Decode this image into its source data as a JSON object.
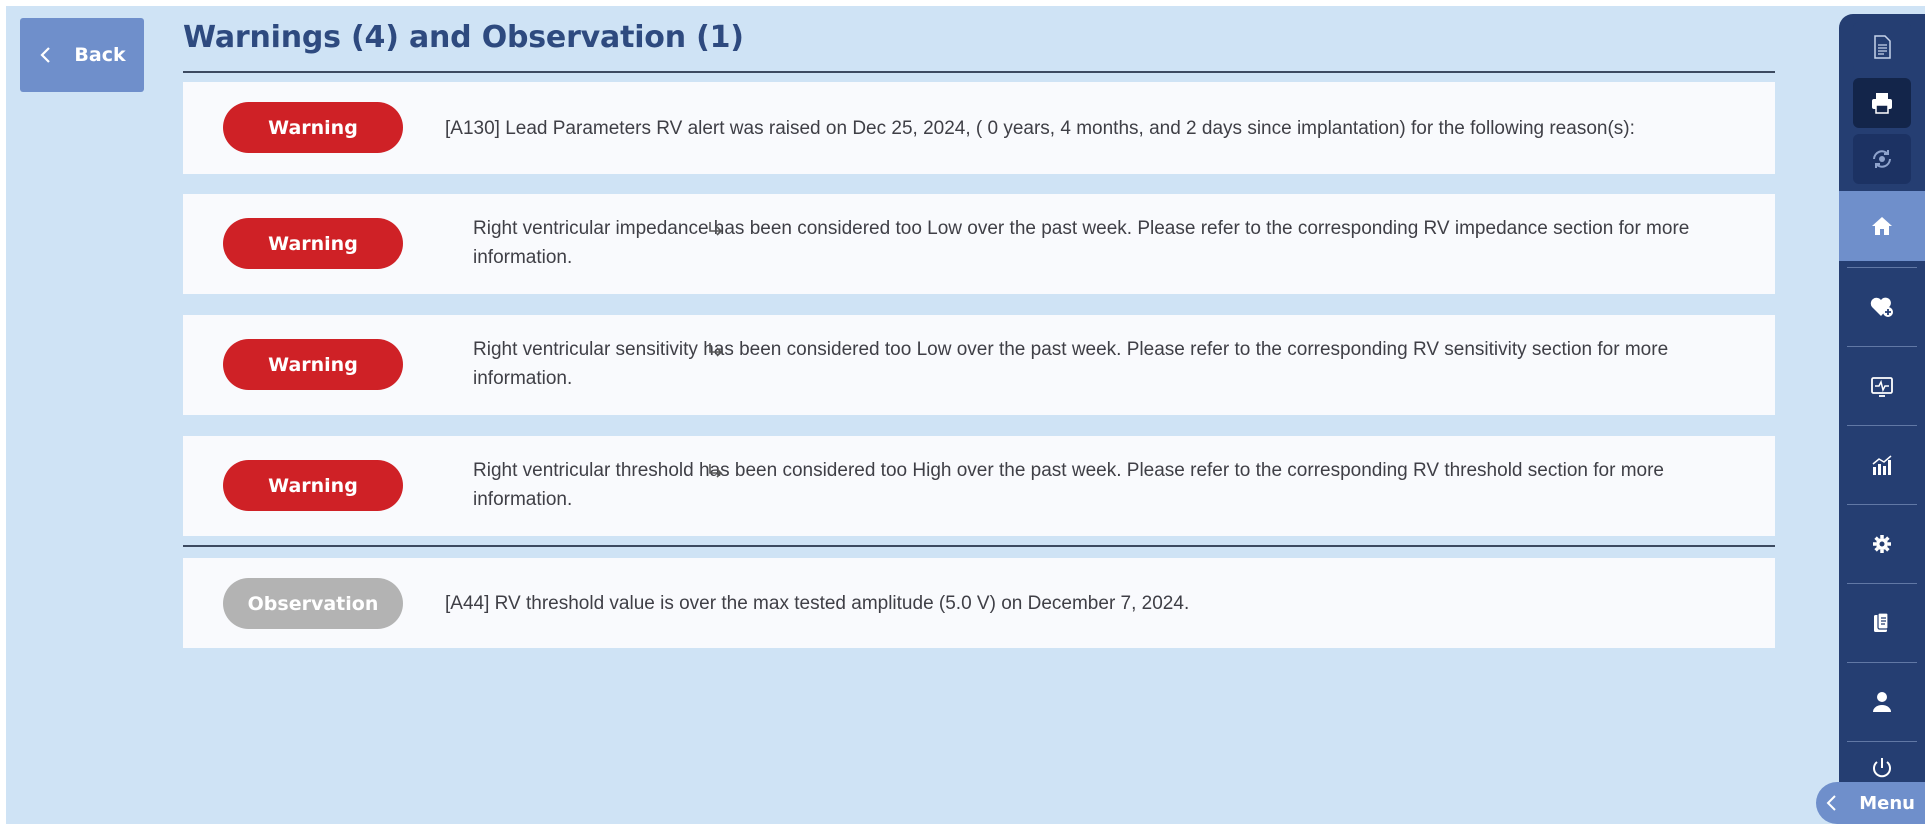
{
  "back_button": {
    "label": "Back"
  },
  "page_title": "Warnings (4) and Observation (1)",
  "warnings": [
    {
      "badge": "Warning",
      "text": "[A130] Lead Parameters RV alert was raised on Dec 25, 2024, ( 0 years, 4 months, and 2 days since implantation) for the following reason(s):"
    },
    {
      "badge": "Warning",
      "text": "Right ventricular impedance has been considered too Low over the past week. Please refer to the corresponding RV impedance section for more information."
    },
    {
      "badge": "Warning",
      "text": "Right ventricular sensitivity has been considered too Low over the past week. Please refer to the corresponding RV sensitivity section for more information."
    },
    {
      "badge": "Warning",
      "text": "Right ventricular threshold has been considered too High over the past week. Please refer to the corresponding RV threshold section for more information."
    }
  ],
  "observation": {
    "badge": "Observation",
    "text": "[A44] RV threshold value is over the max tested amplitude (5.0 V) on December 7, 2024."
  },
  "sidebar": {
    "items": [
      {
        "icon": "document-icon"
      },
      {
        "icon": "printer-icon"
      },
      {
        "icon": "sync-icon"
      },
      {
        "icon": "home-icon",
        "active": true
      },
      {
        "icon": "heart-plus-icon"
      },
      {
        "icon": "monitor-ecg-icon"
      },
      {
        "icon": "bar-chart-icon"
      },
      {
        "icon": "gear-icon"
      },
      {
        "icon": "clipboard-report-icon"
      },
      {
        "icon": "user-icon"
      },
      {
        "icon": "power-icon"
      }
    ],
    "menu_label": "Menu"
  },
  "colors": {
    "background": "#cfe3f5",
    "warning": "#cf2126",
    "observation": "#b3b3b3",
    "sidebar": "#253e72",
    "accent": "#6f8fcb",
    "title": "#2e4a7f"
  }
}
